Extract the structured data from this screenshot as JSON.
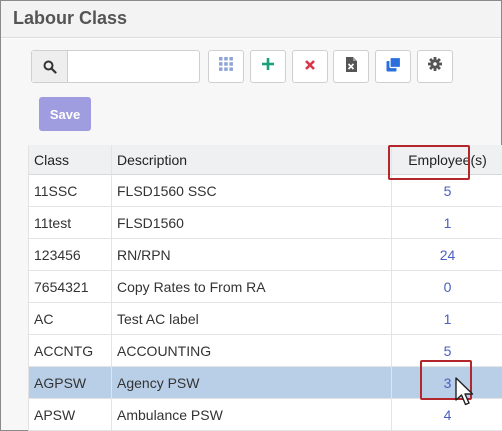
{
  "window": {
    "title": "Labour Class"
  },
  "toolbar": {
    "search_placeholder": "",
    "search_value": "",
    "buttons": [
      {
        "name": "grid-view-button",
        "icon": "grid-icon",
        "color": "#8ea3d6"
      },
      {
        "name": "add-button",
        "icon": "plus-icon",
        "color": "#1aa37a"
      },
      {
        "name": "delete-button",
        "icon": "close-icon",
        "color": "#d9344a"
      },
      {
        "name": "export-excel-button",
        "icon": "excel-icon",
        "color": "#555555"
      },
      {
        "name": "copy-button",
        "icon": "copy-icon",
        "color": "#2a6fdb"
      },
      {
        "name": "settings-button",
        "icon": "gear-icon",
        "color": "#555555"
      }
    ],
    "save_label": "Save"
  },
  "table": {
    "headers": {
      "class": "Class",
      "description": "Description",
      "employees": "Employee(s)"
    },
    "rows": [
      {
        "class": "11SSC",
        "description": "FLSD1560 SSC",
        "employees": "5"
      },
      {
        "class": "11test",
        "description": "FLSD1560",
        "employees": "1"
      },
      {
        "class": "123456",
        "description": "RN/RPN",
        "employees": "24"
      },
      {
        "class": "7654321",
        "description": "Copy Rates to From RA",
        "employees": "0"
      },
      {
        "class": "AC",
        "description": "Test AC label",
        "employees": "1"
      },
      {
        "class": "ACCNTG",
        "description": "ACCOUNTING",
        "employees": "5"
      },
      {
        "class": "AGPSW",
        "description": "Agency PSW",
        "employees": "3",
        "selected": true
      },
      {
        "class": "APSW",
        "description": "Ambulance PSW",
        "employees": "4"
      }
    ]
  }
}
